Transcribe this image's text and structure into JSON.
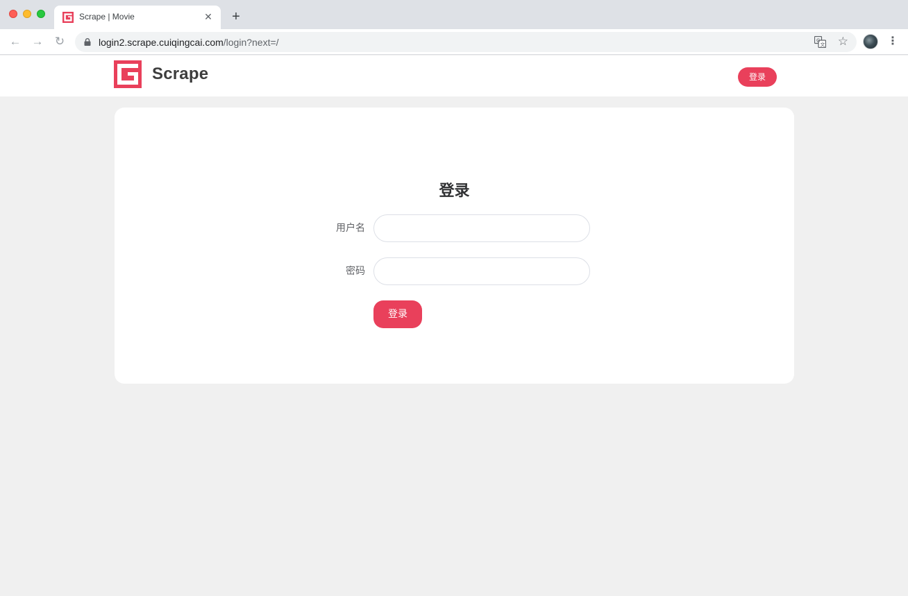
{
  "browser": {
    "tab_title": "Scrape | Movie",
    "tab_close": "✕",
    "new_tab": "+",
    "url_host": "login2.scrape.cuiqingcai.com",
    "url_path": "/login?next=/",
    "back_icon": "←",
    "forward_icon": "→",
    "reload_icon": "↻",
    "star_icon": "☆",
    "menu_icon": "⋮"
  },
  "header": {
    "brand": "Scrape",
    "login_button": "登录"
  },
  "login": {
    "title": "登录",
    "username_label": "用户名",
    "username_value": "",
    "password_label": "密码",
    "password_value": "",
    "submit_label": "登录"
  },
  "colors": {
    "accent": "#e9405b",
    "page_bg": "#f0f0f0",
    "card_bg": "#ffffff"
  }
}
